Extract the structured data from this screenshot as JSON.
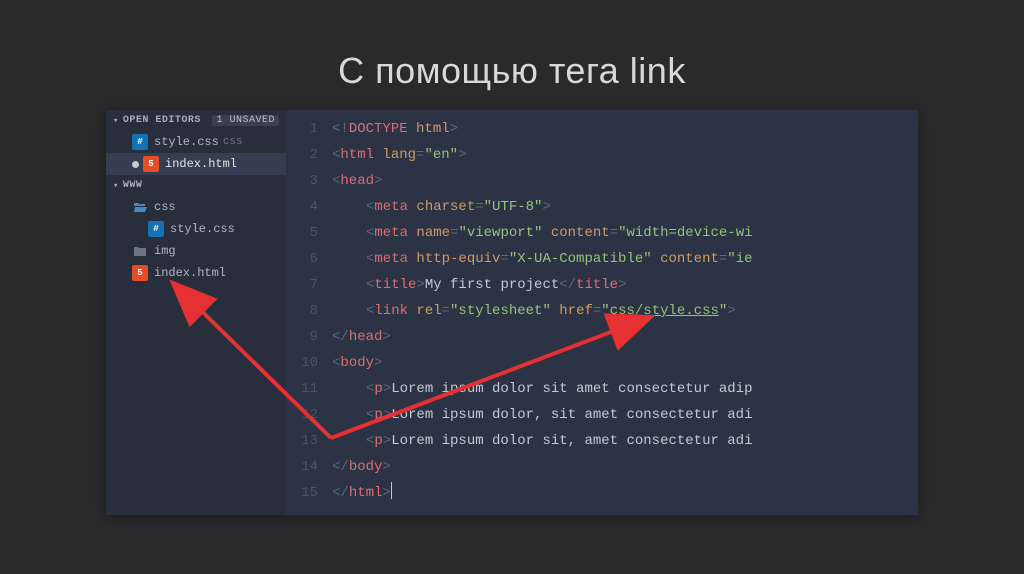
{
  "title": "С помощью тега link",
  "sidebar": {
    "open_editors_label": "OPEN EDITORS",
    "unsaved_badge": "1 UNSAVED",
    "editor_items": [
      {
        "name": "style.css",
        "desc": "css",
        "icon": "css",
        "unsaved": false
      },
      {
        "name": "index.html",
        "desc": "",
        "icon": "html5",
        "unsaved": true,
        "selected": true
      }
    ],
    "workspace_label": "WWW",
    "tree": [
      {
        "name": "css",
        "icon": "folder-open",
        "indent": 1
      },
      {
        "name": "style.css",
        "icon": "css",
        "indent": 2
      },
      {
        "name": "img",
        "icon": "folder",
        "indent": 1
      },
      {
        "name": "index.html",
        "icon": "html5",
        "indent": 1
      }
    ]
  },
  "code": {
    "lines": [
      {
        "n": 1,
        "tokens": [
          {
            "t": "<!",
            "c": "bracket"
          },
          {
            "t": "DOCTYPE",
            "c": "doctype"
          },
          {
            "t": " html",
            "c": "attr"
          },
          {
            "t": ">",
            "c": "bracket"
          }
        ]
      },
      {
        "n": 2,
        "tokens": [
          {
            "t": "<",
            "c": "bracket"
          },
          {
            "t": "html",
            "c": "tag"
          },
          {
            "t": " lang",
            "c": "attr"
          },
          {
            "t": "=",
            "c": "bracket"
          },
          {
            "t": "\"en\"",
            "c": "string"
          },
          {
            "t": ">",
            "c": "bracket"
          }
        ]
      },
      {
        "n": 3,
        "tokens": [
          {
            "t": "<",
            "c": "bracket"
          },
          {
            "t": "head",
            "c": "tag"
          },
          {
            "t": ">",
            "c": "bracket"
          }
        ]
      },
      {
        "n": 4,
        "indent": 1,
        "tokens": [
          {
            "t": "<",
            "c": "bracket"
          },
          {
            "t": "meta",
            "c": "tag"
          },
          {
            "t": " charset",
            "c": "attr"
          },
          {
            "t": "=",
            "c": "bracket"
          },
          {
            "t": "\"UTF-8\"",
            "c": "string"
          },
          {
            "t": ">",
            "c": "bracket"
          }
        ]
      },
      {
        "n": 5,
        "indent": 1,
        "tokens": [
          {
            "t": "<",
            "c": "bracket"
          },
          {
            "t": "meta",
            "c": "tag"
          },
          {
            "t": " name",
            "c": "attr"
          },
          {
            "t": "=",
            "c": "bracket"
          },
          {
            "t": "\"viewport\"",
            "c": "string"
          },
          {
            "t": " content",
            "c": "attr"
          },
          {
            "t": "=",
            "c": "bracket"
          },
          {
            "t": "\"width=device-wi",
            "c": "string"
          }
        ]
      },
      {
        "n": 6,
        "indent": 1,
        "tokens": [
          {
            "t": "<",
            "c": "bracket"
          },
          {
            "t": "meta",
            "c": "tag"
          },
          {
            "t": " http-equiv",
            "c": "attr"
          },
          {
            "t": "=",
            "c": "bracket"
          },
          {
            "t": "\"X-UA-Compatible\"",
            "c": "string"
          },
          {
            "t": " content",
            "c": "attr"
          },
          {
            "t": "=",
            "c": "bracket"
          },
          {
            "t": "\"ie",
            "c": "string"
          }
        ]
      },
      {
        "n": 7,
        "indent": 1,
        "tokens": [
          {
            "t": "<",
            "c": "bracket"
          },
          {
            "t": "title",
            "c": "tag"
          },
          {
            "t": ">",
            "c": "bracket"
          },
          {
            "t": "My first project",
            "c": "text"
          },
          {
            "t": "</",
            "c": "bracket"
          },
          {
            "t": "title",
            "c": "tag"
          },
          {
            "t": ">",
            "c": "bracket"
          }
        ]
      },
      {
        "n": 8,
        "indent": 1,
        "tokens": [
          {
            "t": "<",
            "c": "bracket"
          },
          {
            "t": "link",
            "c": "tag"
          },
          {
            "t": " rel",
            "c": "attr"
          },
          {
            "t": "=",
            "c": "bracket"
          },
          {
            "t": "\"stylesheet\"",
            "c": "string"
          },
          {
            "t": " href",
            "c": "attr"
          },
          {
            "t": "=",
            "c": "bracket"
          },
          {
            "t": "\"",
            "c": "string"
          },
          {
            "t": "css/style.css",
            "c": "string",
            "ul": true
          },
          {
            "t": "\"",
            "c": "string"
          },
          {
            "t": ">",
            "c": "bracket"
          }
        ]
      },
      {
        "n": 9,
        "tokens": [
          {
            "t": "</",
            "c": "bracket"
          },
          {
            "t": "head",
            "c": "tag"
          },
          {
            "t": ">",
            "c": "bracket"
          }
        ]
      },
      {
        "n": 10,
        "tokens": [
          {
            "t": "<",
            "c": "bracket"
          },
          {
            "t": "body",
            "c": "tag"
          },
          {
            "t": ">",
            "c": "bracket"
          }
        ]
      },
      {
        "n": 11,
        "indent": 1,
        "tokens": [
          {
            "t": "<",
            "c": "bracket"
          },
          {
            "t": "p",
            "c": "tag"
          },
          {
            "t": ">",
            "c": "bracket"
          },
          {
            "t": "Lorem ipsum dolor sit amet consectetur adip",
            "c": "text"
          }
        ]
      },
      {
        "n": 12,
        "indent": 1,
        "tokens": [
          {
            "t": "<",
            "c": "bracket"
          },
          {
            "t": "p",
            "c": "tag"
          },
          {
            "t": ">",
            "c": "bracket"
          },
          {
            "t": "Lorem ipsum dolor, sit amet consectetur adi",
            "c": "text"
          }
        ]
      },
      {
        "n": 13,
        "indent": 1,
        "tokens": [
          {
            "t": "<",
            "c": "bracket"
          },
          {
            "t": "p",
            "c": "tag"
          },
          {
            "t": ">",
            "c": "bracket"
          },
          {
            "t": "Lorem ipsum dolor sit, amet consectetur adi",
            "c": "text"
          }
        ]
      },
      {
        "n": 14,
        "tokens": [
          {
            "t": "</",
            "c": "bracket"
          },
          {
            "t": "body",
            "c": "tag"
          },
          {
            "t": ">",
            "c": "bracket"
          }
        ]
      },
      {
        "n": 15,
        "tokens": [
          {
            "t": "</",
            "c": "bracket"
          },
          {
            "t": "html",
            "c": "tag"
          },
          {
            "t": ">",
            "c": "bracket"
          },
          {
            "t": "",
            "c": "cursor"
          }
        ]
      }
    ]
  }
}
